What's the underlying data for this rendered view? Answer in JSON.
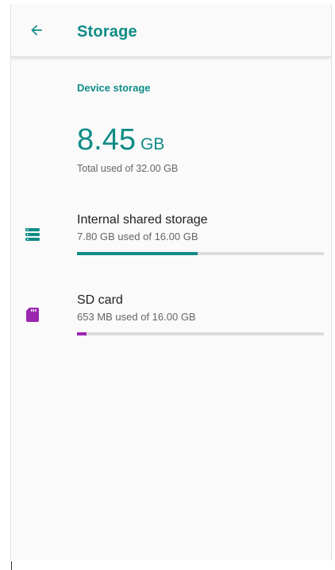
{
  "header": {
    "back_icon": "arrow-back-icon",
    "title": "Storage"
  },
  "device_storage": {
    "section_title": "Device storage",
    "total_used_value": "8.45",
    "total_used_unit": "GB",
    "total_caption": "Total used of 32.00 GB"
  },
  "items": [
    {
      "label": "Internal shared storage",
      "summary": "7.80 GB used of 16.00 GB",
      "icon": "storage-stack-icon",
      "color": "#0f8c86",
      "used_fraction": 0.4875
    },
    {
      "label": "SD card",
      "summary": "653 MB used of 16.00 GB",
      "icon": "sd-card-icon",
      "color": "#9c27b0",
      "used_fraction": 0.04
    }
  ],
  "colors": {
    "accent": "#0f8c86",
    "sd_accent": "#9c27b0",
    "track": "#dcdcdc"
  }
}
